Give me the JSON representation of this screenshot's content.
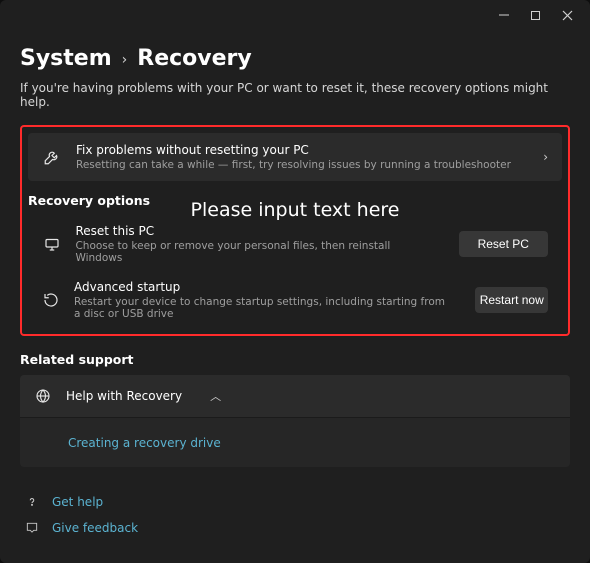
{
  "breadcrumb": {
    "root": "System",
    "page": "Recovery"
  },
  "intro": "If you're having problems with your PC or want to reset it, these recovery options might help.",
  "overlay": "Please input text here",
  "fix": {
    "title": "Fix problems without resetting your PC",
    "desc": "Resetting can take a while — first, try resolving issues by running a troubleshooter"
  },
  "recovery_section_title": "Recovery options",
  "reset": {
    "title": "Reset this PC",
    "desc": "Choose to keep or remove your personal files, then reinstall Windows",
    "button": "Reset PC"
  },
  "advanced": {
    "title": "Advanced startup",
    "desc": "Restart your device to change startup settings, including starting from a disc or USB drive",
    "button": "Restart now"
  },
  "related_title": "Related support",
  "help_recovery": {
    "title": "Help with Recovery"
  },
  "link_recovery_drive": "Creating a recovery drive",
  "get_help": "Get help",
  "give_feedback": "Give feedback"
}
